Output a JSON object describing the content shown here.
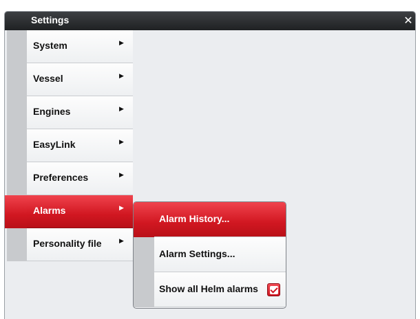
{
  "window": {
    "title": "Settings",
    "close_glyph": "✕"
  },
  "menu": {
    "items": [
      {
        "label": "System",
        "arrow": "▶"
      },
      {
        "label": "Vessel",
        "arrow": "▶"
      },
      {
        "label": "Engines",
        "arrow": "▶"
      },
      {
        "label": "EasyLink",
        "arrow": "▶"
      },
      {
        "label": "Preferences",
        "arrow": "▶"
      },
      {
        "label": "Alarms",
        "arrow": "▶",
        "active": true
      },
      {
        "label": "Personality file",
        "arrow": "▶"
      }
    ]
  },
  "submenu": {
    "items": [
      {
        "label": "Alarm History...",
        "active": true
      },
      {
        "label": "Alarm Settings..."
      },
      {
        "label": "Show all Helm alarms",
        "checked": true
      }
    ]
  },
  "colors": {
    "accent_red": "#d11721",
    "titlebar": "#2b2d30",
    "panel": "#ebedf0"
  },
  "icons": {
    "close": "close-icon",
    "submenu_arrow": "chevron-right-icon",
    "checkbox": "checkbox-checked-icon"
  }
}
